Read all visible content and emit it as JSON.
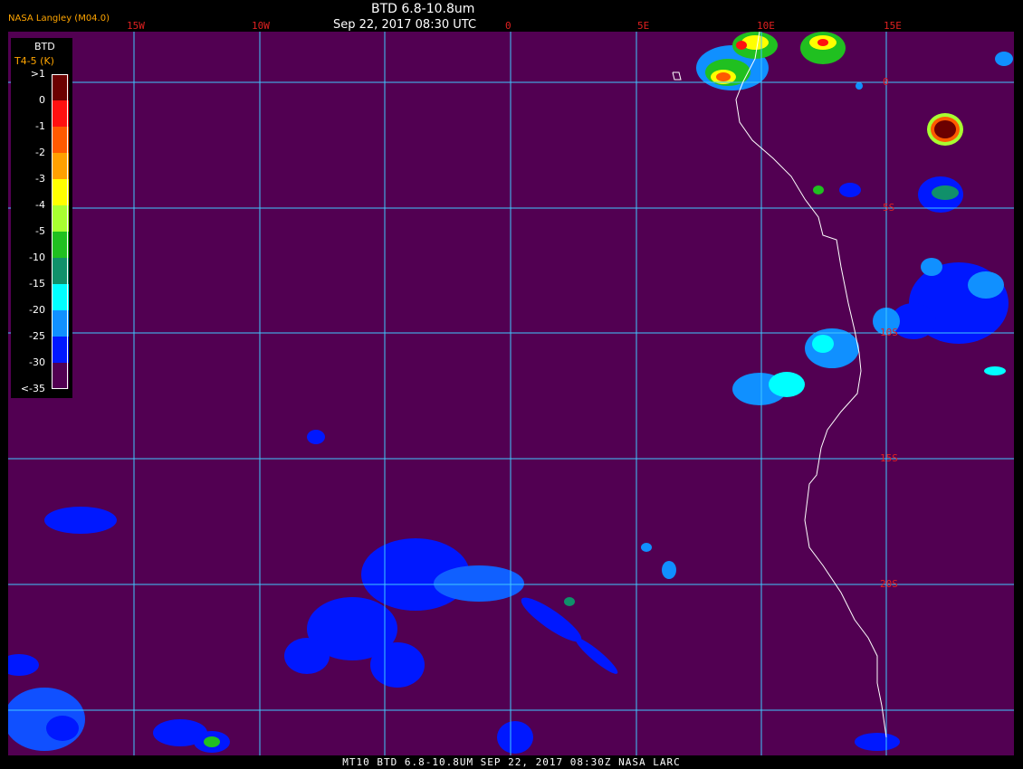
{
  "header": {
    "credit": "NASA Langley (M04.0)",
    "title": "BTD 6.8-10.8um",
    "subtitle": "Sep 22, 2017 08:30 UTC"
  },
  "longitude_labels": [
    "15W",
    "10W",
    "0",
    "5E",
    "10E",
    "15E"
  ],
  "latitude_labels": [
    "0",
    "5S",
    "10S",
    "15S",
    "20S"
  ],
  "legend": {
    "title": "BTD",
    "subtitle": "T4-5 (K)",
    "levels": [
      {
        "label": ">1",
        "color": "#6b0000"
      },
      {
        "label": "0",
        "color": "#ff1010"
      },
      {
        "label": "-1",
        "color": "#ff5a00"
      },
      {
        "label": "-2",
        "color": "#ffa000"
      },
      {
        "label": "-3",
        "color": "#ffff00"
      },
      {
        "label": "-4",
        "color": "#a8ff30"
      },
      {
        "label": "-5",
        "color": "#20c020"
      },
      {
        "label": "-10",
        "color": "#10906a"
      },
      {
        "label": "-15",
        "color": "#00ffff"
      },
      {
        "label": "-20",
        "color": "#1090ff"
      },
      {
        "label": "-25",
        "color": "#0018ff"
      },
      {
        "label": "-30",
        "color": "#520052"
      },
      {
        "label": "<-35",
        "color": ""
      }
    ]
  },
  "map": {
    "background_color": "#520052",
    "grid_color": "#40c8ff",
    "coast_color": "#ffffff"
  },
  "footer": "MT10  BTD 6.8-10.8UM  SEP 22, 2017 08:30Z  NASA LARC"
}
